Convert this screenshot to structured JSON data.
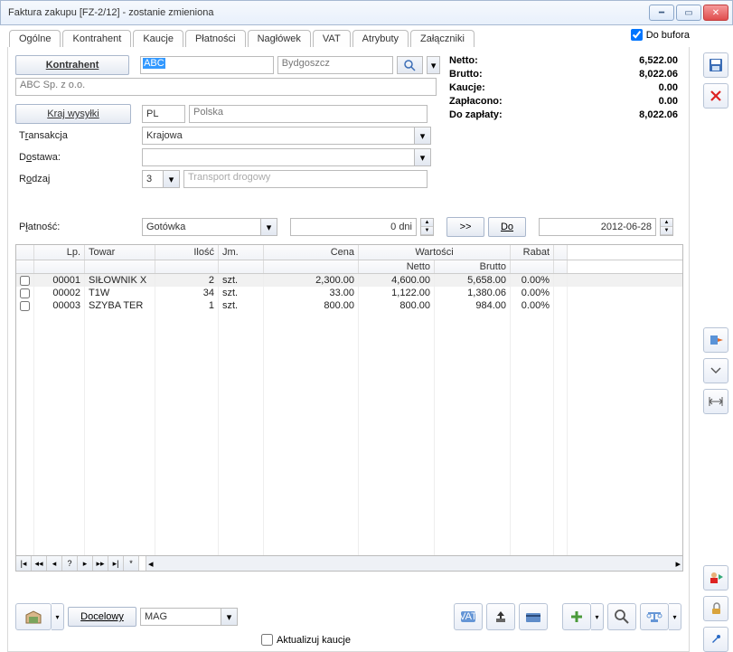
{
  "window": {
    "title": "Faktura zakupu [FZ-2/12]  - zostanie zmieniona"
  },
  "tabs": [
    "Ogólne",
    "Kontrahent",
    "Kaucje",
    "Płatności",
    "Nagłówek",
    "VAT",
    "Atrybuty",
    "Załączniki"
  ],
  "buforaLabel": "Do bufora",
  "form": {
    "kontrahentBtn": "Kontrahent",
    "kontrahentCode": "ABC",
    "kontrahentCity": "Bydgoszcz",
    "companyName": "ABC Sp. z o.o.",
    "krajBtn": "Kraj wysyłki",
    "countryCode": "PL",
    "countryName": "Polska",
    "transakcjaLabelPre": "T",
    "transakcjaLabelUl": "r",
    "transakcjaLabelPost": "ansakcja",
    "transakcjaVal": "Krajowa",
    "dostawaLabelPre": "D",
    "dostawaLabelUl": "o",
    "dostawaLabelPost": "stawa:",
    "rodzajLabelPre": "R",
    "rodzajLabelUl": "o",
    "rodzajLabelPost": "dzaj",
    "rodzajNum": "3",
    "rodzajDesc": "Transport drogowy",
    "platnoscLabelPre": "P",
    "platnoscLabelUl": "ł",
    "platnoscLabelPost": "atność:",
    "platnoscVal": "Gotówka",
    "dni": "0 dni",
    "forward": ">>",
    "doBtn": "Do",
    "date": "2012-06-28"
  },
  "summary": {
    "nettoL": "Netto:",
    "nettoV": "6,522.00",
    "bruttoL": "Brutto:",
    "bruttoV": "8,022.06",
    "kaucjeL": "Kaucje:",
    "kaucjeV": "0.00",
    "zaplL": "Zapłacono:",
    "zaplV": "0.00",
    "dozapL": "Do zapłaty:",
    "dozapV": "8,022.06"
  },
  "grid": {
    "h": {
      "lp": "Lp.",
      "towar": "Towar",
      "ilosc": "Ilość",
      "jm": "Jm.",
      "cena": "Cena",
      "wart": "Wartości",
      "netto": "Netto",
      "brutto": "Brutto",
      "rabat": "Rabat"
    },
    "rows": [
      {
        "lp": "00001",
        "towar": "SIŁOWNIK X",
        "il": "2",
        "jm": "szt.",
        "cena": "2,300.00",
        "net": "4,600.00",
        "bru": "5,658.00",
        "rab": "0.00%"
      },
      {
        "lp": "00002",
        "towar": "T1W",
        "il": "34",
        "jm": "szt.",
        "cena": "33.00",
        "net": "1,122.00",
        "bru": "1,380.06",
        "rab": "0.00%"
      },
      {
        "lp": "00003",
        "towar": "SZYBA TER",
        "il": "1",
        "jm": "szt.",
        "cena": "800.00",
        "net": "800.00",
        "bru": "984.00",
        "rab": "0.00%"
      }
    ]
  },
  "footer": {
    "docelowyLabel": "Docelowy",
    "mag": "MAG",
    "aktualizuj": "Aktualizuj kaucje"
  }
}
